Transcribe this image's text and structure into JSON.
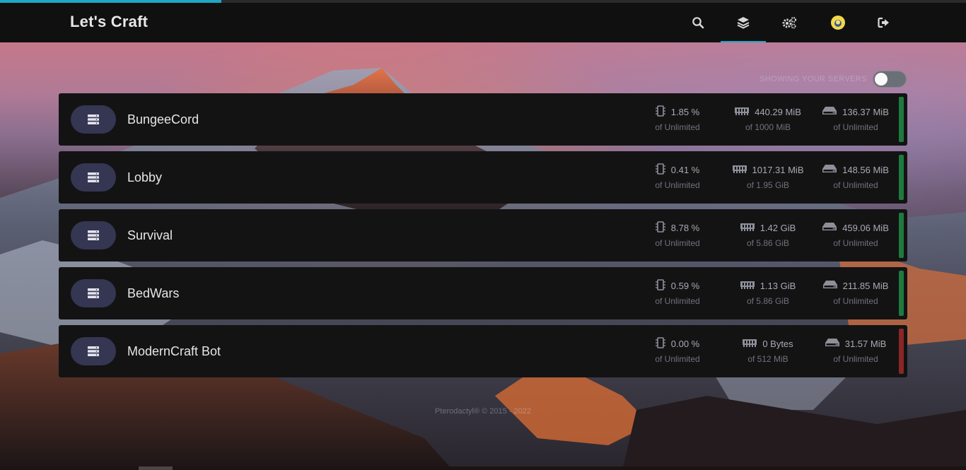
{
  "app": {
    "title": "Let's Craft"
  },
  "header": {
    "icons": [
      "search-icon",
      "layers-icon",
      "cogs-icon",
      "avatar",
      "sign-out-icon"
    ],
    "active_nav": "servers"
  },
  "toggle": {
    "label": "SHOWING YOUR SERVERS",
    "state": false
  },
  "servers": [
    {
      "name": "BungeeCord",
      "cpu": {
        "value": "1.85 %",
        "limit": "of Unlimited"
      },
      "memory": {
        "value": "440.29 MiB",
        "limit": "of 1000 MiB"
      },
      "disk": {
        "value": "136.37 MiB",
        "limit": "of Unlimited"
      },
      "status": "running",
      "status_color": "#1f7a3f"
    },
    {
      "name": "Lobby",
      "cpu": {
        "value": "0.41 %",
        "limit": "of Unlimited"
      },
      "memory": {
        "value": "1017.31 MiB",
        "limit": "of 1.95 GiB"
      },
      "disk": {
        "value": "148.56 MiB",
        "limit": "of Unlimited"
      },
      "status": "running",
      "status_color": "#1f7a3f"
    },
    {
      "name": "Survival",
      "cpu": {
        "value": "8.78 %",
        "limit": "of Unlimited"
      },
      "memory": {
        "value": "1.42 GiB",
        "limit": "of 5.86 GiB"
      },
      "disk": {
        "value": "459.06 MiB",
        "limit": "of Unlimited"
      },
      "status": "running",
      "status_color": "#1f7a3f"
    },
    {
      "name": "BedWars",
      "cpu": {
        "value": "0.59 %",
        "limit": "of Unlimited"
      },
      "memory": {
        "value": "1.13 GiB",
        "limit": "of 5.86 GiB"
      },
      "disk": {
        "value": "211.85 MiB",
        "limit": "of Unlimited"
      },
      "status": "running",
      "status_color": "#1f7a3f"
    },
    {
      "name": "ModernCraft Bot",
      "cpu": {
        "value": "0.00 %",
        "limit": "of Unlimited"
      },
      "memory": {
        "value": "0 Bytes",
        "limit": "of 512 MiB"
      },
      "disk": {
        "value": "31.57 MiB",
        "limit": "of Unlimited"
      },
      "status": "offline",
      "status_color": "#8a2626"
    }
  ],
  "footer": {
    "text": "Pterodactyl® © 2015 - 2022"
  },
  "colors": {
    "accent": "#1ea7c4",
    "row_bg": "#131314",
    "icon_pill": "#343652"
  }
}
